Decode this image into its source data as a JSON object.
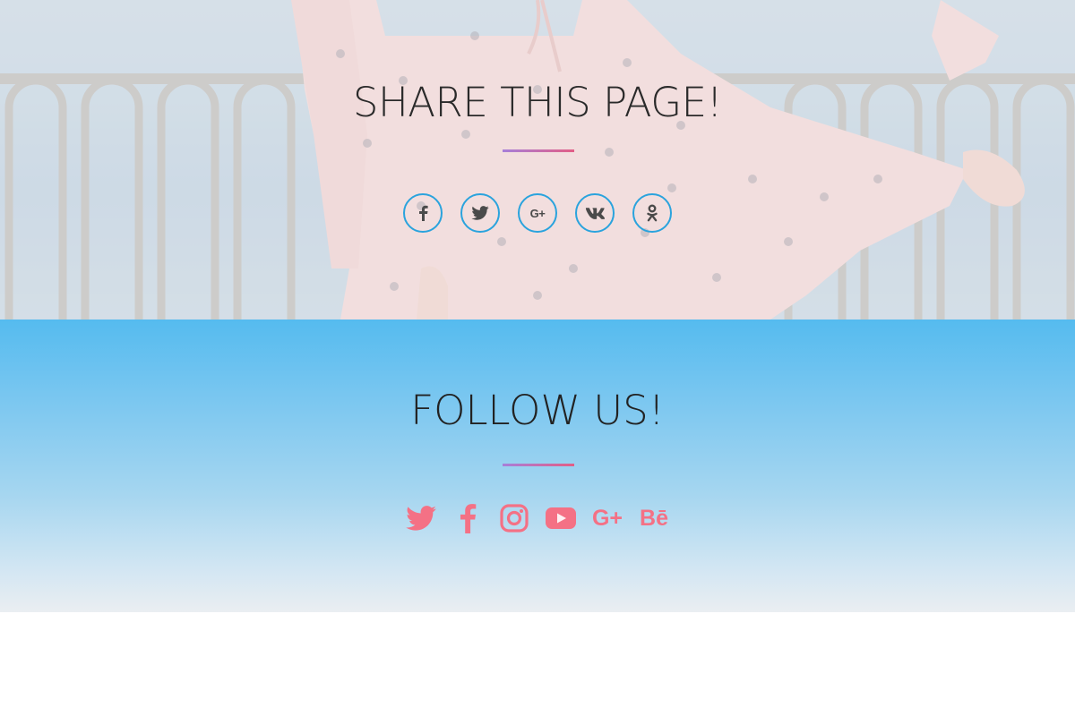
{
  "share": {
    "title": "SHARE THIS PAGE!",
    "buttons": [
      {
        "icon": "facebook-icon"
      },
      {
        "icon": "twitter-icon"
      },
      {
        "icon": "google-plus-icon",
        "label": "G+"
      },
      {
        "icon": "vk-icon"
      },
      {
        "icon": "odnoklassniki-icon"
      }
    ],
    "ring_color": "#2aa3dd",
    "icon_color": "#4a4a4a"
  },
  "follow": {
    "title": "FOLLOW US!",
    "icons": [
      {
        "icon": "twitter-icon"
      },
      {
        "icon": "facebook-icon"
      },
      {
        "icon": "instagram-icon"
      },
      {
        "icon": "youtube-icon"
      },
      {
        "icon": "google-plus-icon",
        "label": "G+"
      },
      {
        "icon": "behance-icon",
        "label": "Bē"
      }
    ],
    "icon_color": "#f47185"
  },
  "colors": {
    "divider_start": "#a77fd9",
    "divider_end": "#e25e86",
    "follow_bg_top": "#55bbef",
    "follow_bg_bottom": "#eaeef2"
  }
}
